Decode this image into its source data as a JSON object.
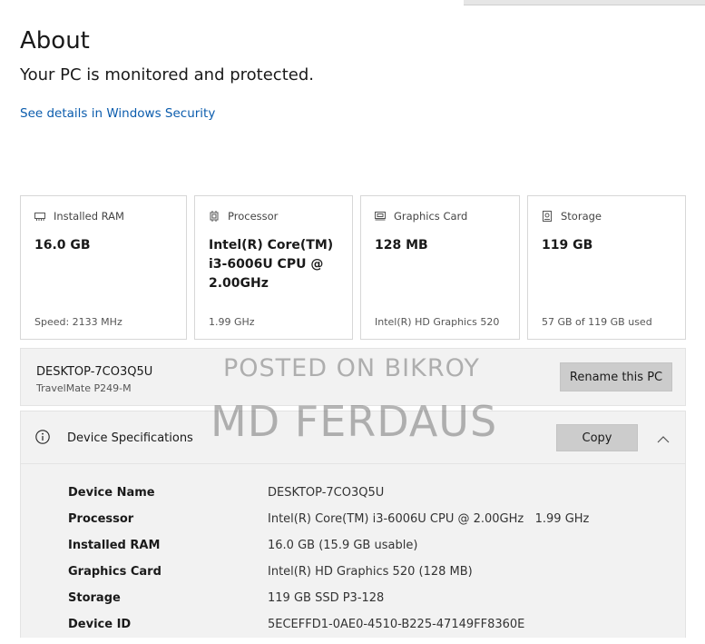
{
  "page": {
    "title": "About",
    "status": "Your PC is monitored and protected.",
    "security_link": "See details in Windows Security"
  },
  "cards": [
    {
      "icon": "ram-icon",
      "label": "Installed RAM",
      "value": "16.0 GB",
      "footer": "Speed: 2133 MHz"
    },
    {
      "icon": "processor-icon",
      "label": "Processor",
      "value": "Intel(R) Core(TM) i3-6006U CPU @ 2.00GHz",
      "footer": "1.99 GHz"
    },
    {
      "icon": "graphics-card-icon",
      "label": "Graphics Card",
      "value": "128 MB",
      "footer": "Intel(R) HD Graphics 520"
    },
    {
      "icon": "storage-icon",
      "label": "Storage",
      "value": "119 GB",
      "footer": "57 GB of 119 GB used"
    }
  ],
  "device": {
    "name": "DESKTOP-7CO3Q5U",
    "model": "TravelMate P249-M",
    "rename_label": "Rename this PC"
  },
  "watermark": {
    "line1": "POSTED ON BIKROY",
    "line2": "MD FERDAUS"
  },
  "specs": {
    "title": "Device Specifications",
    "copy_label": "Copy",
    "rows": [
      {
        "key": "Device Name",
        "value": "DESKTOP-7CO3Q5U"
      },
      {
        "key": "Processor",
        "value": "Intel(R) Core(TM) i3-6006U CPU @ 2.00GHz   1.99 GHz"
      },
      {
        "key": "Installed RAM",
        "value": "16.0 GB (15.9 GB usable)"
      },
      {
        "key": "Graphics Card",
        "value": "Intel(R) HD Graphics 520 (128 MB)"
      },
      {
        "key": "Storage",
        "value": "119 GB SSD P3-128"
      },
      {
        "key": "Device ID",
        "value": "5ECEFFD1-0AE0-4510-B225-47149FF8360E"
      }
    ]
  },
  "colors": {
    "link": "#0b5cad",
    "panel_bg": "#f2f2f2",
    "button_bg": "#cccccc"
  }
}
